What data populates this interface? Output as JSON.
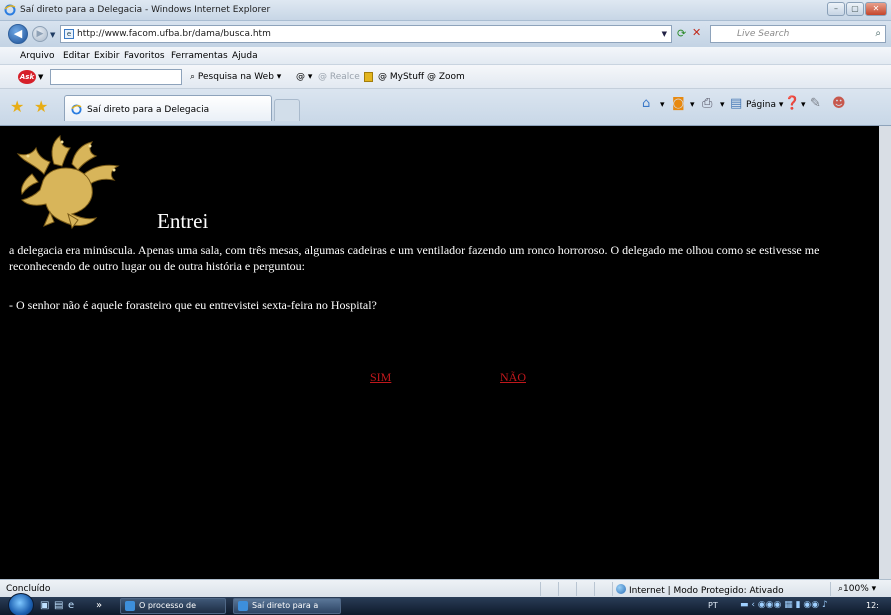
{
  "window": {
    "title": "Saí direto para a Delegacia - Windows Internet Explorer",
    "buttons": [
      "–",
      "▢",
      "✕"
    ]
  },
  "address_bar": {
    "url": "http://www.facom.ufba.br/dama/busca.htm",
    "search_placeholder": "Live Search"
  },
  "menu": [
    "Arquivo",
    "Editar",
    "Exibir",
    "Favoritos",
    "Ferramentas",
    "Ajuda"
  ],
  "ask_toolbar": {
    "logo": "Ask",
    "items": [
      "Pesquisa na Web ▾",
      "▾",
      "Realce",
      "MyStuff",
      "Zoom"
    ]
  },
  "tabs": {
    "active_label": "Saí direto para a Delegacia"
  },
  "command_bar": {
    "page_label": "Página ▾"
  },
  "page": {
    "heading": "Entrei",
    "paragraph": "a delegacia era minúscula. Apenas uma sala, com três mesas, algumas cadeiras e um ventilador fazendo um ronco horroroso. O delegado me olhou  como se estivesse me reconhecendo de outro lugar ou de outra história e perguntou:",
    "question": "- O senhor não é aquele forasteiro que eu entrevistei sexta-feira no Hospital?",
    "choices": [
      "SIM",
      "NÃO"
    ],
    "colors": {
      "background": "#000000",
      "text": "#ffffff",
      "link": "#c0181c"
    }
  },
  "status_bar": {
    "status": "Concluído",
    "zone": "Internet | Modo Protegido: Ativado",
    "zoom": "100%"
  },
  "taskbar": {
    "tasks": [
      "O processo de leitur...",
      "Saí direto para a Del..."
    ],
    "language": "PT",
    "clock": "12:"
  }
}
